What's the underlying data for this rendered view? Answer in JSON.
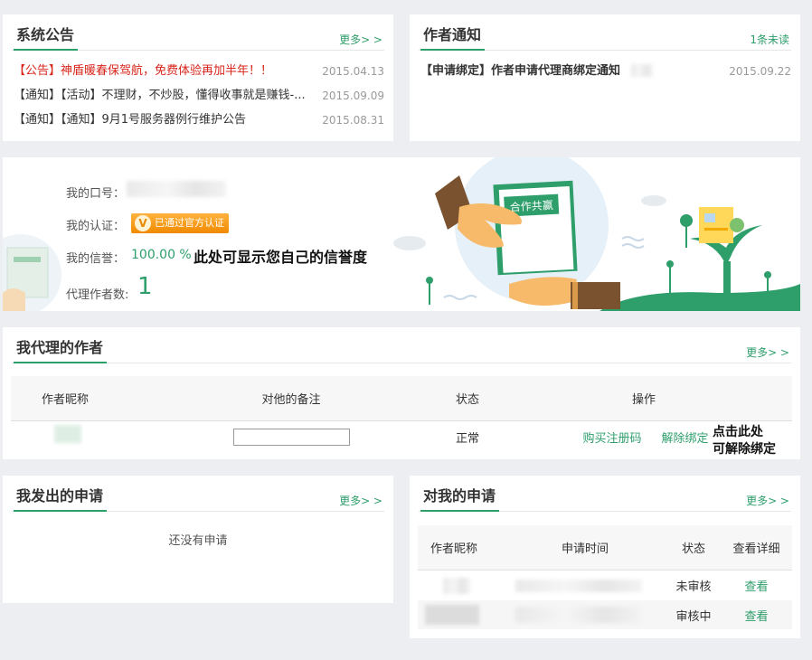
{
  "system_notice": {
    "title": "系统公告",
    "more": "更多> >",
    "items": [
      {
        "text": "【公告】神盾暖春保驾航，免费体验再加半年！！",
        "date": "2015.04.13",
        "highlight": true
      },
      {
        "text": "【通知】【活动】不理财，不炒股，懂得收事就是赚钱-...",
        "date": "2015.09.09",
        "highlight": false
      },
      {
        "text": "【通知】【通知】9月1号服务器例行维护公告",
        "date": "2015.08.31",
        "highlight": false
      }
    ]
  },
  "author_notice": {
    "title": "作者通知",
    "unread": "1条未读",
    "items": [
      {
        "text": "【申请绑定】作者申请代理商绑定通知",
        "date": "2015.09.22"
      }
    ]
  },
  "profile": {
    "password_label": "我的口号：",
    "cert_label": "我的认证：",
    "cert_badge": "已通过官方认证",
    "credit_label": "我的信誉：",
    "credit_value": "100.00 %",
    "credit_note": "此处可显示您自己的信誉度",
    "count_label": "代理作者数:",
    "count_value": "1",
    "banner_sign": "合作共赢"
  },
  "my_authors": {
    "title": "我代理的作者",
    "more": "更多> >",
    "columns": [
      "作者昵称",
      "对他的备注",
      "状态",
      "操作"
    ],
    "rows": [
      {
        "status": "正常",
        "buy_action": "购买注册码",
        "unbind_action": "解除绑定"
      }
    ],
    "annotation_line1": "点击此处",
    "annotation_line2": "可解除绑定"
  },
  "sent_requests": {
    "title": "我发出的申请",
    "more": "更多> >",
    "empty": "还没有申请"
  },
  "received_requests": {
    "title": "对我的申请",
    "more": "更多> >",
    "columns": [
      "作者昵称",
      "申请时间",
      "状态",
      "查看详细"
    ],
    "rows": [
      {
        "status": "未审核",
        "action": "查看"
      },
      {
        "status": "审核中",
        "action": "查看"
      }
    ]
  },
  "colors": {
    "accent": "#2e9e6b",
    "warning": "#f08a00",
    "alert": "#d9241a"
  }
}
